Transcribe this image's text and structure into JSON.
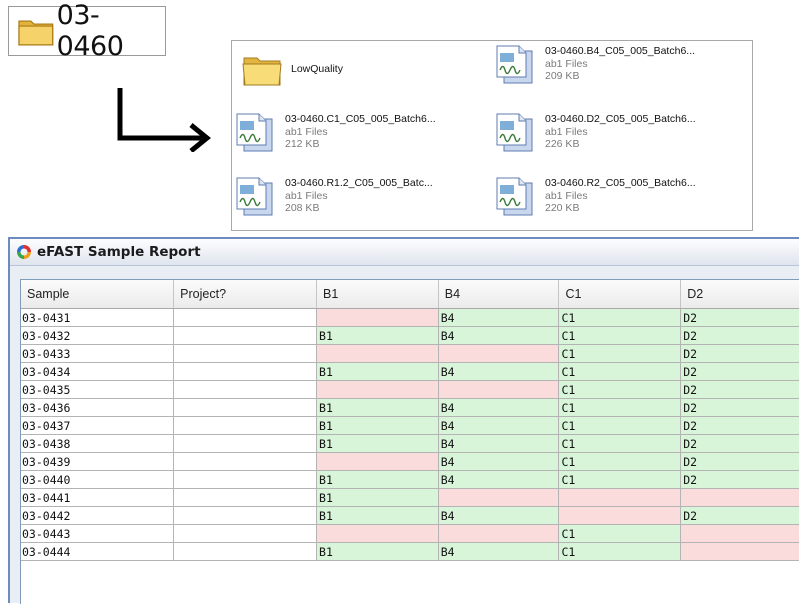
{
  "folder": {
    "name": "03-0460",
    "icon": "folder-icon"
  },
  "files": [
    {
      "name": "LowQuality",
      "type": "",
      "size": "",
      "icon": "folder-icon"
    },
    {
      "name": "03-0460.B4_C05_005_Batch6...",
      "type": "ab1 Files",
      "size": "209 KB",
      "icon": "ab1-file-icon"
    },
    {
      "name": "03-0460.C1_C05_005_Batch6...",
      "type": "ab1 Files",
      "size": "212 KB",
      "icon": "ab1-file-icon"
    },
    {
      "name": "03-0460.D2_C05_005_Batch6...",
      "type": "ab1 Files",
      "size": "226 KB",
      "icon": "ab1-file-icon"
    },
    {
      "name": "03-0460.R1.2_C05_005_Batc...",
      "type": "ab1 Files",
      "size": "208 KB",
      "icon": "ab1-file-icon"
    },
    {
      "name": "03-0460.R2_C05_005_Batch6...",
      "type": "ab1 Files",
      "size": "220 KB",
      "icon": "ab1-file-icon"
    }
  ],
  "report": {
    "title": "eFAST Sample Report",
    "columns": [
      "Sample",
      "Project?",
      "B1",
      "B4",
      "C1",
      "D2"
    ],
    "colors": {
      "present": "#d9f5d9",
      "missing": "#fadcdc"
    },
    "rows": [
      {
        "sample": "03-0431",
        "project": "",
        "B1": null,
        "B4": "B4",
        "C1": "C1",
        "D2": "D2"
      },
      {
        "sample": "03-0432",
        "project": "",
        "B1": "B1",
        "B4": "B4",
        "C1": "C1",
        "D2": "D2"
      },
      {
        "sample": "03-0433",
        "project": "",
        "B1": null,
        "B4": null,
        "C1": "C1",
        "D2": "D2"
      },
      {
        "sample": "03-0434",
        "project": "",
        "B1": "B1",
        "B4": "B4",
        "C1": "C1",
        "D2": "D2"
      },
      {
        "sample": "03-0435",
        "project": "",
        "B1": null,
        "B4": null,
        "C1": "C1",
        "D2": "D2"
      },
      {
        "sample": "03-0436",
        "project": "",
        "B1": "B1",
        "B4": "B4",
        "C1": "C1",
        "D2": "D2"
      },
      {
        "sample": "03-0437",
        "project": "",
        "B1": "B1",
        "B4": "B4",
        "C1": "C1",
        "D2": "D2"
      },
      {
        "sample": "03-0438",
        "project": "",
        "B1": "B1",
        "B4": "B4",
        "C1": "C1",
        "D2": "D2"
      },
      {
        "sample": "03-0439",
        "project": "",
        "B1": null,
        "B4": "B4",
        "C1": "C1",
        "D2": "D2"
      },
      {
        "sample": "03-0440",
        "project": "",
        "B1": "B1",
        "B4": "B4",
        "C1": "C1",
        "D2": "D2"
      },
      {
        "sample": "03-0441",
        "project": "",
        "B1": "B1",
        "B4": null,
        "C1": null,
        "D2": null
      },
      {
        "sample": "03-0442",
        "project": "",
        "B1": "B1",
        "B4": "B4",
        "C1": null,
        "D2": "D2"
      },
      {
        "sample": "03-0443",
        "project": "",
        "B1": null,
        "B4": null,
        "C1": "C1",
        "D2": null
      },
      {
        "sample": "03-0444",
        "project": "",
        "B1": "B1",
        "B4": "B4",
        "C1": "C1",
        "D2": null
      }
    ]
  }
}
